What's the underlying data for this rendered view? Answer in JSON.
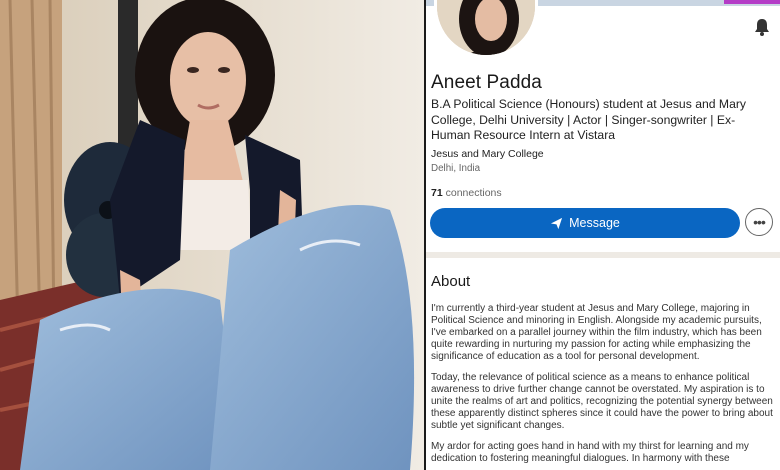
{
  "profile": {
    "name": "Aneet Padda",
    "headline": "B.A Political Science (Honours) student at Jesus and Mary College, Delhi University | Actor | Singer-songwriter | Ex-Human Resource Intern at Vistara",
    "education": "Jesus and Mary College",
    "location": "Delhi, India",
    "connections_count": "71",
    "connections_label": "connections"
  },
  "actions": {
    "message_label": "Message",
    "more_label": "•••"
  },
  "about": {
    "title": "About",
    "paragraphs": [
      "I'm currently a third-year student at Jesus and Mary College, majoring in Political Science and minoring in English. Alongside my academic pursuits, I've embarked on a parallel journey within the film industry, which has been quite rewarding in nurturing my passion for acting while emphasizing the significance of education as a tool for personal development.",
      "Today, the relevance of political science as a means to enhance political awareness to drive further change cannot be overstated. My aspiration is to unite the realms of art and politics, recognizing the potential synergy between these apparently distinct spheres since it could have the power to bring about subtle yet significant changes.",
      "My ardor for acting goes hand in hand with my thirst for learning and my dedication to fostering meaningful dialogues. In harmony with these"
    ]
  },
  "colors": {
    "primary": "#0a66c2",
    "accent_bar": "#b43cc6"
  },
  "icons": {
    "notification": "bell-icon",
    "send": "send-icon"
  }
}
